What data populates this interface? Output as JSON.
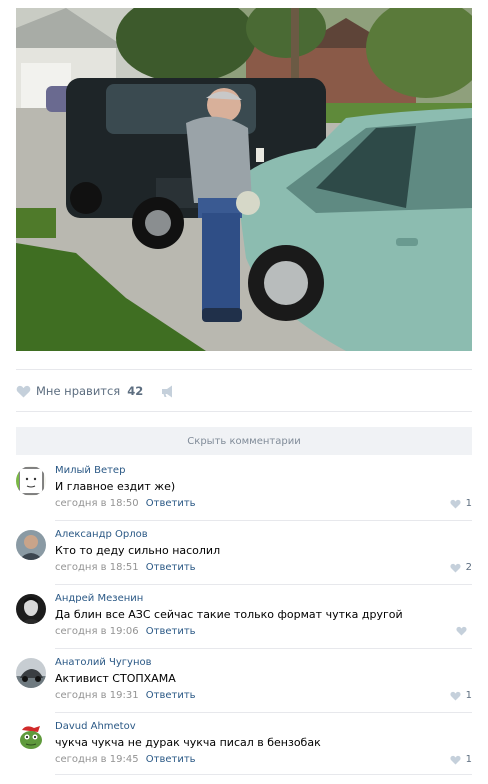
{
  "post": {
    "photo_alt": "",
    "likes_label": "Мне нравится",
    "likes_count": "42",
    "hide_comments_label": "Скрыть комментарии"
  },
  "colors": {
    "link": "#2a5885",
    "meta": "#939393",
    "icon": "#aeb7c2",
    "bar_bg": "#f0f2f5"
  },
  "comments": [
    {
      "author": "Милый Ветер",
      "text": "И главное ездит же)",
      "time": "сегодня в 18:50",
      "reply": "Ответить",
      "likes": "1",
      "avatar_icon": "avatar-sketch-face"
    },
    {
      "author": "Александр Орлов",
      "text": "Кто то деду сильно насолил",
      "time": "сегодня в 18:51",
      "reply": "Ответить",
      "likes": "2",
      "avatar_icon": "avatar-man-photo"
    },
    {
      "author": "Андрей Мезенин",
      "text": "Да блин все АЗС сейчас такие только формат чутка другой",
      "time": "сегодня в 19:06",
      "reply": "Ответить",
      "likes": "",
      "avatar_icon": "avatar-dark-portrait"
    },
    {
      "author": "Анатолий Чугунов",
      "text": "Активист СТОПХАМА",
      "time": "сегодня в 19:31",
      "reply": "Ответить",
      "likes": "1",
      "avatar_icon": "avatar-car-photo"
    },
    {
      "author": "Davud Ahmetov",
      "text": "чукча чукча не дурак чукча писал в бензобак",
      "time": "сегодня в 19:45",
      "reply": "Ответить",
      "likes": "1",
      "avatar_icon": "avatar-frog-cartoon"
    }
  ]
}
